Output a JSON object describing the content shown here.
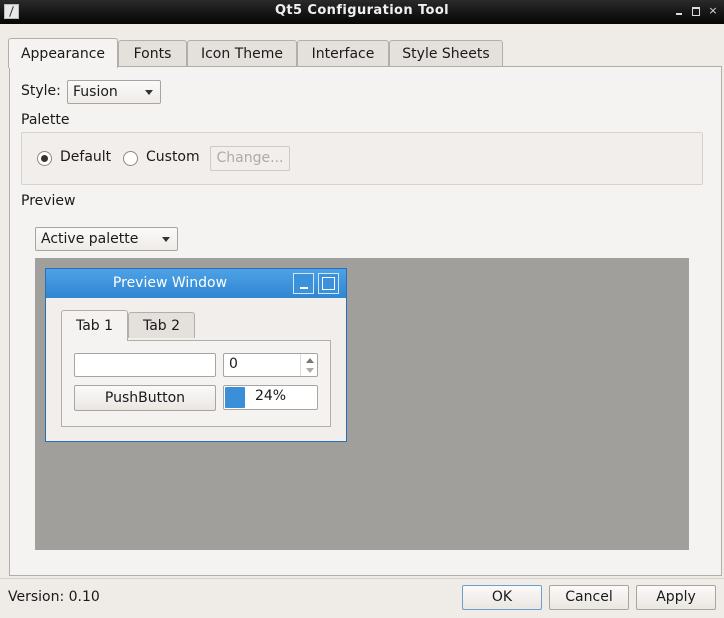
{
  "window": {
    "title": "Qt5 Configuration Tool"
  },
  "tabs": [
    "Appearance",
    "Fonts",
    "Icon Theme",
    "Interface",
    "Style Sheets"
  ],
  "style": {
    "label": "Style:",
    "value": "Fusion"
  },
  "palette": {
    "label": "Palette",
    "default_label": "Default",
    "custom_label": "Custom",
    "change_label": "Change...",
    "selected": "Default"
  },
  "preview": {
    "label": "Preview",
    "palette_select": "Active palette",
    "window_title": "Preview Window",
    "tabs": [
      "Tab 1",
      "Tab 2"
    ],
    "line_edit": "",
    "spin_value": "0",
    "push_button": "PushButton",
    "progress_value": 0.24,
    "progress_text": "24%"
  },
  "footer": {
    "version": "Version: 0.10",
    "ok": "OK",
    "cancel": "Cancel",
    "apply": "Apply"
  },
  "colors": {
    "accent": "#3a8fd8",
    "preview_bg": "#a19f9c",
    "titlebar": "#0a0a0a"
  }
}
